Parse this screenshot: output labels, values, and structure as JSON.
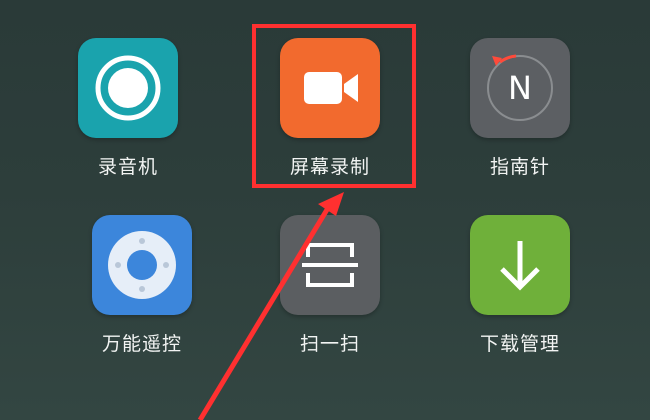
{
  "apps": [
    {
      "id": "recorder",
      "label": "录音机",
      "icon": "record-icon",
      "color": "#1aa3ad"
    },
    {
      "id": "screen",
      "label": "屏幕录制",
      "icon": "video-camera-icon",
      "color": "#f26a2e"
    },
    {
      "id": "compass",
      "label": "指南针",
      "icon": "compass-icon",
      "color": "#5c5f63"
    },
    {
      "id": "remote",
      "label": "万能遥控",
      "icon": "remote-control-icon",
      "color": "#3c86db"
    },
    {
      "id": "scan",
      "label": "扫一扫",
      "icon": "scan-icon",
      "color": "#5b5e61"
    },
    {
      "id": "download",
      "label": "下载管理",
      "icon": "download-icon",
      "color": "#6fb03a"
    }
  ],
  "compass_letter": "N",
  "annotation": {
    "highlight_color": "#ff3030",
    "highlighted_app": "screen"
  }
}
